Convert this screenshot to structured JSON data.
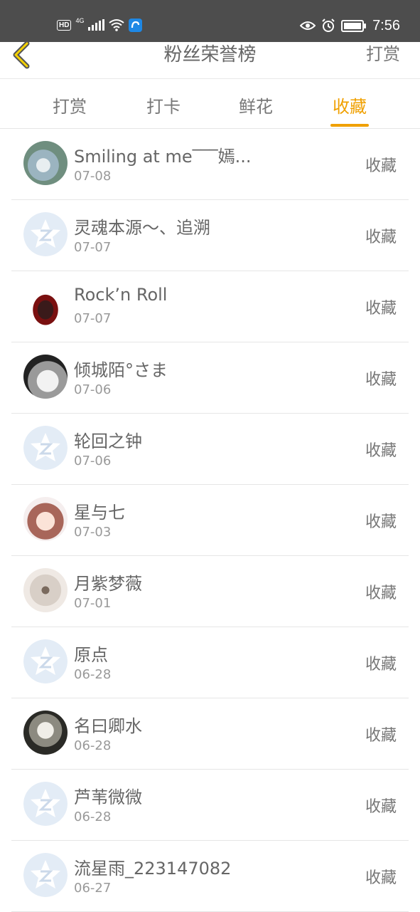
{
  "status_bar": {
    "hd": "HD",
    "network": "4G",
    "time": "7:56",
    "icons": [
      "signal-icon",
      "wifi-icon",
      "app-icon",
      "eye-icon",
      "alarm-icon",
      "battery-icon"
    ]
  },
  "header": {
    "back_icon": "chevron-left-icon",
    "title": "粉丝荣誉榜",
    "action": "打赏"
  },
  "tabs": [
    {
      "label": "打赏"
    },
    {
      "label": "打卡"
    },
    {
      "label": "鲜花"
    },
    {
      "label": "收藏",
      "active": true
    }
  ],
  "accent_color": "#f0a000",
  "fans": [
    {
      "name": "Smiling at me‾‾‾嫣...",
      "date": "07-08",
      "action": "收藏",
      "avatar": "photo"
    },
    {
      "name": "灵魂本源～、追溯",
      "date": "07-07",
      "action": "收藏",
      "avatar": "default"
    },
    {
      "name": "Rock’n Roll",
      "date": "07-07",
      "action": "收藏",
      "avatar": "photo"
    },
    {
      "name": "倾城陌°さま",
      "date": "07-06",
      "action": "收藏",
      "avatar": "photo"
    },
    {
      "name": "轮回之钟",
      "date": "07-06",
      "action": "收藏",
      "avatar": "default"
    },
    {
      "name": "星与七",
      "date": "07-03",
      "action": "收藏",
      "avatar": "photo"
    },
    {
      "name": "月紫梦薇",
      "date": "07-01",
      "action": "收藏",
      "avatar": "photo"
    },
    {
      "name": "原点",
      "date": "06-28",
      "action": "收藏",
      "avatar": "default"
    },
    {
      "name": "名曰卿水",
      "date": "06-28",
      "action": "收藏",
      "avatar": "photo"
    },
    {
      "name": "芦苇微微",
      "date": "06-28",
      "action": "收藏",
      "avatar": "default"
    },
    {
      "name": "流星雨_223147082",
      "date": "06-27",
      "action": "收藏",
      "avatar": "default"
    }
  ]
}
